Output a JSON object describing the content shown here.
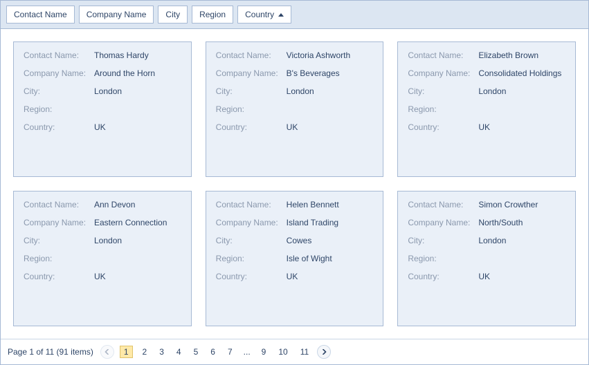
{
  "header": {
    "columns": [
      {
        "label": "Contact Name",
        "sort": "none"
      },
      {
        "label": "Company Name",
        "sort": "none"
      },
      {
        "label": "City",
        "sort": "none"
      },
      {
        "label": "Region",
        "sort": "none"
      },
      {
        "label": "Country",
        "sort": "asc"
      }
    ]
  },
  "fieldLabels": {
    "contactName": "Contact Name:",
    "companyName": "Company Name:",
    "city": "City:",
    "region": "Region:",
    "country": "Country:"
  },
  "cards": [
    {
      "contactName": "Thomas Hardy",
      "companyName": "Around the Horn",
      "city": "London",
      "region": "",
      "country": "UK"
    },
    {
      "contactName": "Victoria Ashworth",
      "companyName": "B's Beverages",
      "city": "London",
      "region": "",
      "country": "UK"
    },
    {
      "contactName": "Elizabeth Brown",
      "companyName": "Consolidated Holdings",
      "city": "London",
      "region": "",
      "country": "UK"
    },
    {
      "contactName": "Ann Devon",
      "companyName": "Eastern Connection",
      "city": "London",
      "region": "",
      "country": "UK"
    },
    {
      "contactName": "Helen Bennett",
      "companyName": "Island Trading",
      "city": "Cowes",
      "region": "Isle of Wight",
      "country": "UK"
    },
    {
      "contactName": "Simon Crowther",
      "companyName": "North/South",
      "city": "London",
      "region": "",
      "country": "UK"
    }
  ],
  "pager": {
    "summary": "Page 1 of 11 (91 items)",
    "currentPage": 1,
    "totalPages": 11,
    "visiblePages": [
      1,
      2,
      3,
      4,
      5,
      6,
      7,
      "...",
      9,
      10,
      11
    ],
    "prevEnabled": false,
    "nextEnabled": true
  }
}
